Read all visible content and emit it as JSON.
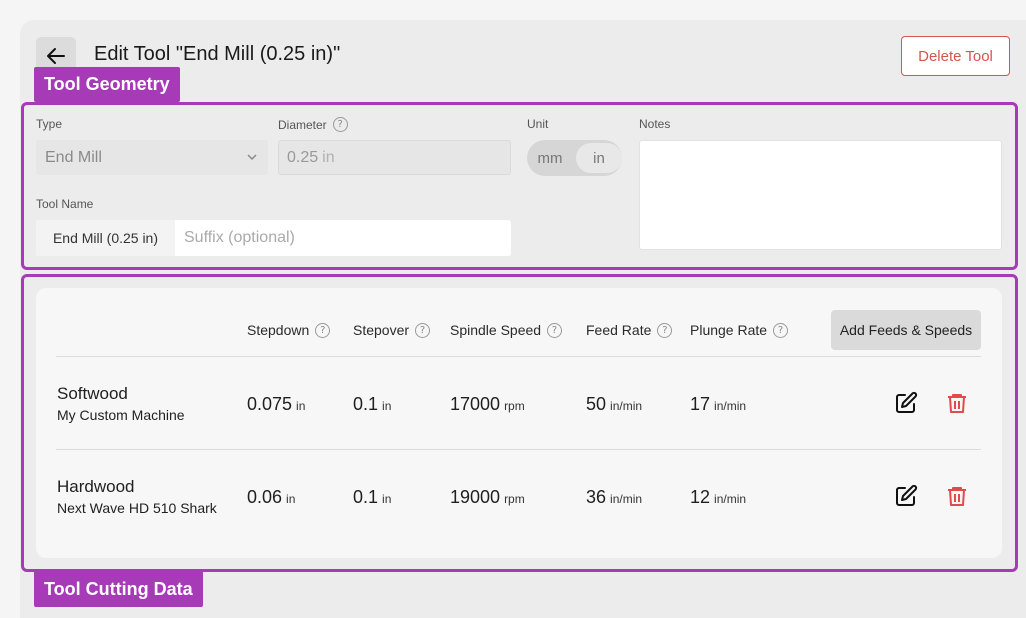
{
  "header": {
    "title": "Edit Tool \"End Mill (0.25 in)\"",
    "delete_label": "Delete Tool"
  },
  "sections": {
    "geometry_tag": "Tool Geometry",
    "cutting_tag": "Tool Cutting Data"
  },
  "geometry": {
    "type_label": "Type",
    "type_value": "End Mill",
    "diameter_label": "Diameter",
    "diameter_value": "0.25",
    "diameter_unit": "in",
    "unit_label": "Unit",
    "unit_options": [
      "mm",
      "in"
    ],
    "unit_selected": "in",
    "notes_label": "Notes",
    "notes_value": "",
    "tool_name_label": "Tool Name",
    "tool_name_prefix": "End Mill (0.25 in)",
    "suffix_placeholder": "Suffix (optional)"
  },
  "table": {
    "headers": [
      "Stepdown",
      "Stepover",
      "Spindle Speed",
      "Feed Rate",
      "Plunge Rate"
    ],
    "add_button": "Add Feeds & Speeds",
    "help_glyph": "?",
    "rows": [
      {
        "material": "Softwood",
        "machine": "My Custom Machine",
        "stepdown": "0.075",
        "stepdown_unit": "in",
        "stepover": "0.1",
        "stepover_unit": "in",
        "spindle": "17000",
        "spindle_unit": "rpm",
        "feed": "50",
        "feed_unit": "in/min",
        "plunge": "17",
        "plunge_unit": "in/min"
      },
      {
        "material": "Hardwood",
        "machine": "Next Wave HD 510 Shark",
        "stepdown": "0.06",
        "stepdown_unit": "in",
        "stepover": "0.1",
        "stepover_unit": "in",
        "spindle": "19000",
        "spindle_unit": "rpm",
        "feed": "36",
        "feed_unit": "in/min",
        "plunge": "12",
        "plunge_unit": "in/min"
      }
    ]
  },
  "icons": {
    "back": "arrow-left-icon",
    "chevron": "chevron-down-icon",
    "help": "help-circle-icon",
    "edit": "edit-icon",
    "trash": "trash-icon"
  },
  "colors": {
    "accent": "#a63ab7",
    "danger": "#d9534f"
  }
}
